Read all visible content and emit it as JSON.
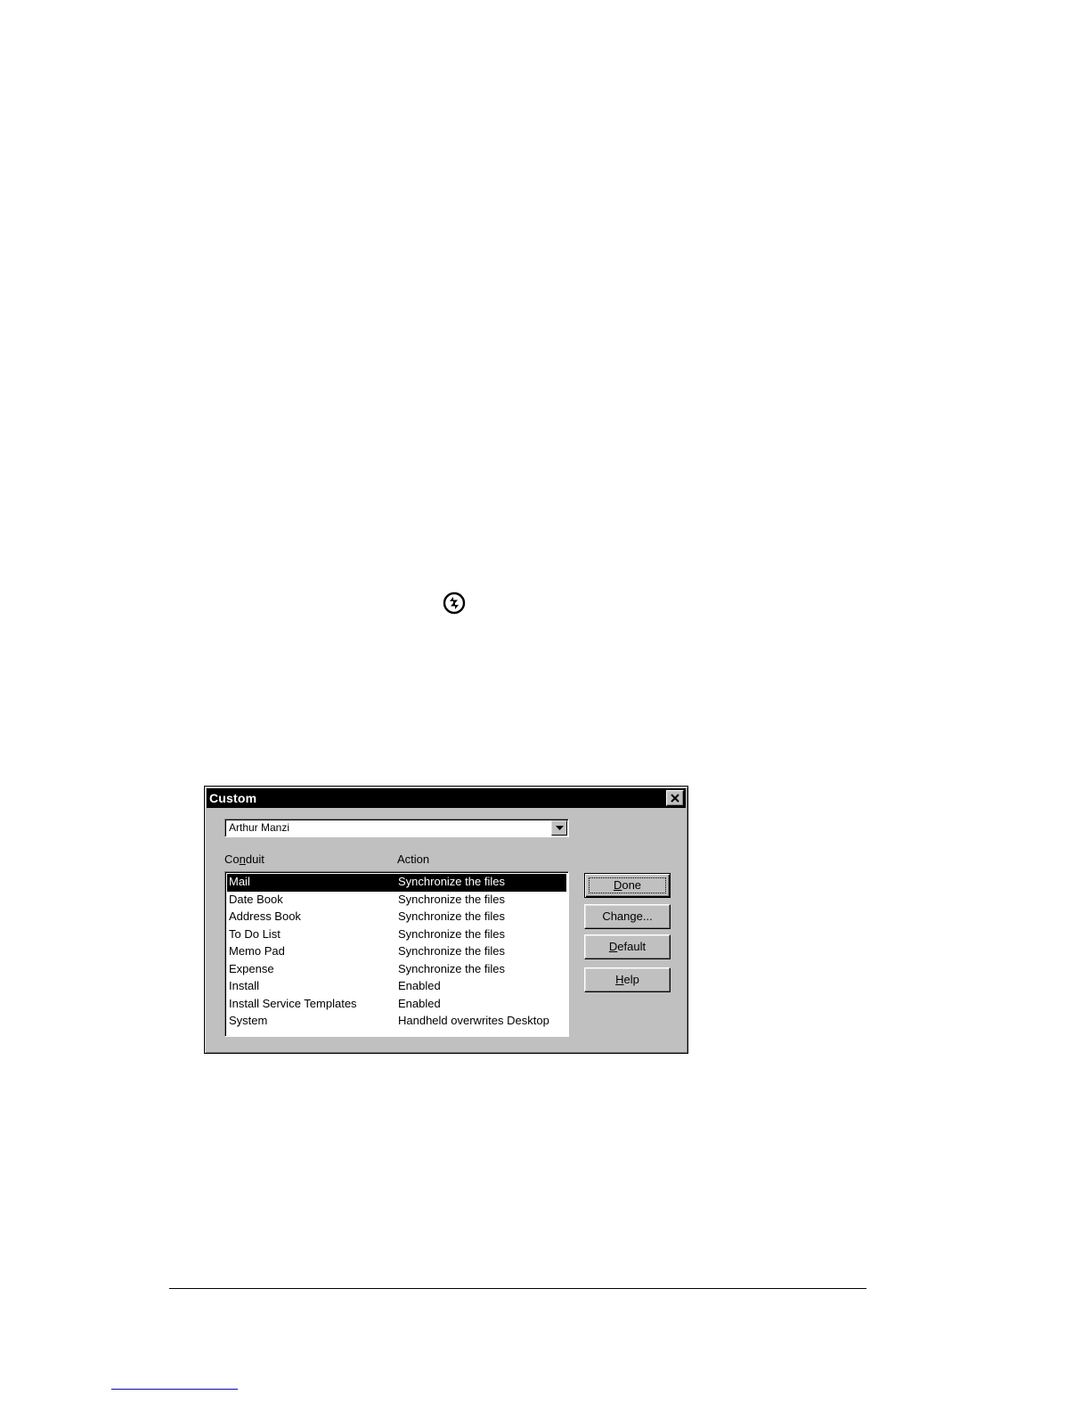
{
  "dialog": {
    "title": "Custom",
    "user": {
      "selected": "Arthur Manzi"
    },
    "columns": {
      "conduit_prefix": "Co",
      "conduit_accel": "n",
      "conduit_suffix": "duit",
      "action": "Action"
    },
    "rows": [
      {
        "conduit": "Mail",
        "action": "Synchronize the files",
        "selected": true
      },
      {
        "conduit": "Date Book",
        "action": "Synchronize the files"
      },
      {
        "conduit": "Address Book",
        "action": "Synchronize the files"
      },
      {
        "conduit": "To Do List",
        "action": "Synchronize the files"
      },
      {
        "conduit": "Memo Pad",
        "action": "Synchronize the files"
      },
      {
        "conduit": "Expense",
        "action": "Synchronize the files"
      },
      {
        "conduit": "Install",
        "action": "Enabled"
      },
      {
        "conduit": "Install Service Templates",
        "action": "Enabled"
      },
      {
        "conduit": "System",
        "action": "Handheld overwrites Desktop"
      }
    ],
    "buttons": {
      "done": {
        "accel": "D",
        "rest": "one"
      },
      "change": {
        "text": "Change..."
      },
      "default": {
        "accel": "D",
        "rest": "efault"
      },
      "help": {
        "accel": "H",
        "rest": "elp"
      }
    }
  },
  "icons": {
    "hotsync": "hotsync-icon",
    "close": "close-icon",
    "dropdown": "chevron-down-icon"
  },
  "colors": {
    "dialog_face": "#c0c0c0",
    "titlebar": "#000000",
    "selection": "#000000",
    "link_rule": "#0000ff"
  }
}
